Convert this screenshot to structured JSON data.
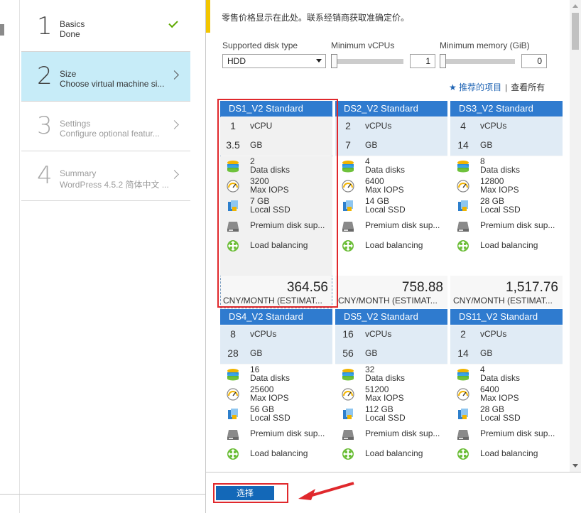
{
  "steps": [
    {
      "num": "1",
      "title": "Basics",
      "sub": "Done",
      "state": "done"
    },
    {
      "num": "2",
      "title": "Size",
      "sub": "Choose virtual machine si...",
      "state": "active"
    },
    {
      "num": "3",
      "title": "Settings",
      "sub": "Configure optional featur...",
      "state": "todo"
    },
    {
      "num": "4",
      "title": "Summary",
      "sub": "WordPress 4.5.2 简体中文 ...",
      "state": "todo"
    }
  ],
  "notice": "零售价格显示在此处。联系经销商获取准确定价。",
  "filters": {
    "disk_label": "Supported disk type",
    "disk_value": "HDD",
    "vcpu_label": "Minimum vCPUs",
    "vcpu_value": "1",
    "mem_label": "Minimum memory (GiB)",
    "mem_value": "0"
  },
  "links": {
    "recommended": "推荐的项目",
    "separator": "|",
    "view_all": "查看所有"
  },
  "cards": [
    {
      "name": "DS1_V2  Standard",
      "cpu": "1",
      "cpu_unit": "vCPU",
      "mem": "3.5",
      "mem_unit": "GB",
      "disks": "2",
      "disks_label": "Data disks",
      "iops": "3200",
      "iops_label": "Max IOPS",
      "ssd": "7 GB",
      "ssd_label": "Local SSD",
      "premium": "Premium disk sup...",
      "lb": "Load balancing",
      "price": "364.56",
      "per": "CNY/MONTH (ESTIMAT..."
    },
    {
      "name": "DS2_V2  Standard",
      "cpu": "2",
      "cpu_unit": "vCPUs",
      "mem": "7",
      "mem_unit": "GB",
      "disks": "4",
      "disks_label": "Data disks",
      "iops": "6400",
      "iops_label": "Max IOPS",
      "ssd": "14 GB",
      "ssd_label": "Local SSD",
      "premium": "Premium disk sup...",
      "lb": "Load balancing",
      "price": "758.88",
      "per": "CNY/MONTH (ESTIMAT..."
    },
    {
      "name": "DS3_V2  Standard",
      "cpu": "4",
      "cpu_unit": "vCPUs",
      "mem": "14",
      "mem_unit": "GB",
      "disks": "8",
      "disks_label": "Data disks",
      "iops": "12800",
      "iops_label": "Max IOPS",
      "ssd": "28 GB",
      "ssd_label": "Local SSD",
      "premium": "Premium disk sup...",
      "lb": "Load balancing",
      "price": "1,517.76",
      "per": "CNY/MONTH (ESTIMAT..."
    },
    {
      "name": "DS4_V2  Standard",
      "cpu": "8",
      "cpu_unit": "vCPUs",
      "mem": "28",
      "mem_unit": "GB",
      "disks": "16",
      "disks_label": "Data disks",
      "iops": "25600",
      "iops_label": "Max IOPS",
      "ssd": "56 GB",
      "ssd_label": "Local SSD",
      "premium": "Premium disk sup...",
      "lb": "Load balancing",
      "price": "",
      "per": ""
    },
    {
      "name": "DS5_V2  Standard",
      "cpu": "16",
      "cpu_unit": "vCPUs",
      "mem": "56",
      "mem_unit": "GB",
      "disks": "32",
      "disks_label": "Data disks",
      "iops": "51200",
      "iops_label": "Max IOPS",
      "ssd": "112 GB",
      "ssd_label": "Local SSD",
      "premium": "Premium disk sup...",
      "lb": "Load balancing",
      "price": "",
      "per": ""
    },
    {
      "name": "DS11_V2  Standard",
      "cpu": "2",
      "cpu_unit": "vCPUs",
      "mem": "14",
      "mem_unit": "GB",
      "disks": "4",
      "disks_label": "Data disks",
      "iops": "6400",
      "iops_label": "Max IOPS",
      "ssd": "28 GB",
      "ssd_label": "Local SSD",
      "premium": "Premium disk sup...",
      "lb": "Load balancing",
      "price": "",
      "per": ""
    }
  ],
  "footer": {
    "select_label": "选择"
  },
  "colors": {
    "accent": "#2f7bcf",
    "active_step": "#c7ecf8",
    "highlight": "#e0282c",
    "notice_bar": "#f2c500",
    "button": "#1368b8"
  },
  "icons": {
    "check": "check-icon",
    "chevron": "chevron-right-icon",
    "disks": "disk-stack-icon",
    "iops": "gauge-icon",
    "ssd": "ssd-icon",
    "premium": "hard-drive-icon",
    "lb": "load-balancer-icon",
    "star": "star-icon",
    "arrow": "red-arrow-icon"
  }
}
